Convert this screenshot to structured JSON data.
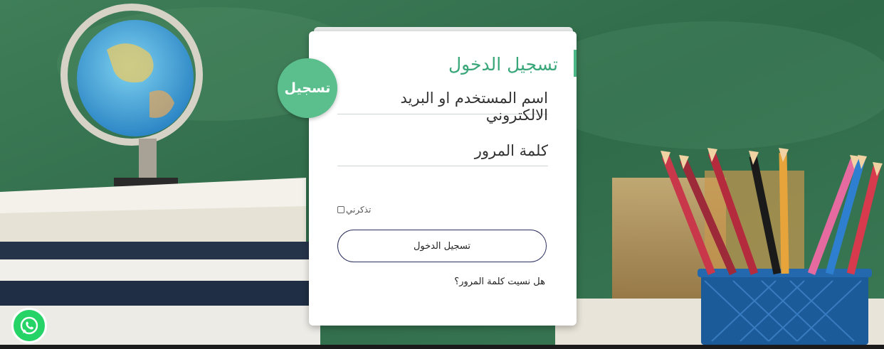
{
  "login": {
    "title": "تسجيل الدخول",
    "badge_label": "تسجيل",
    "username_placeholder": "اسم المستخدم او البريد الالكتروني",
    "password_placeholder": "كلمة المرور",
    "remember_label": "تذكرني",
    "submit_label": "تسجيل الدخول",
    "forgot_label": "هل نسيت كلمة المرور؟"
  },
  "icons": {
    "whatsapp": "whatsapp-icon"
  },
  "colors": {
    "accent": "#4cb887",
    "badge": "#5bbf8d",
    "button_border": "#2b2f5c",
    "whatsapp": "#25d366"
  }
}
